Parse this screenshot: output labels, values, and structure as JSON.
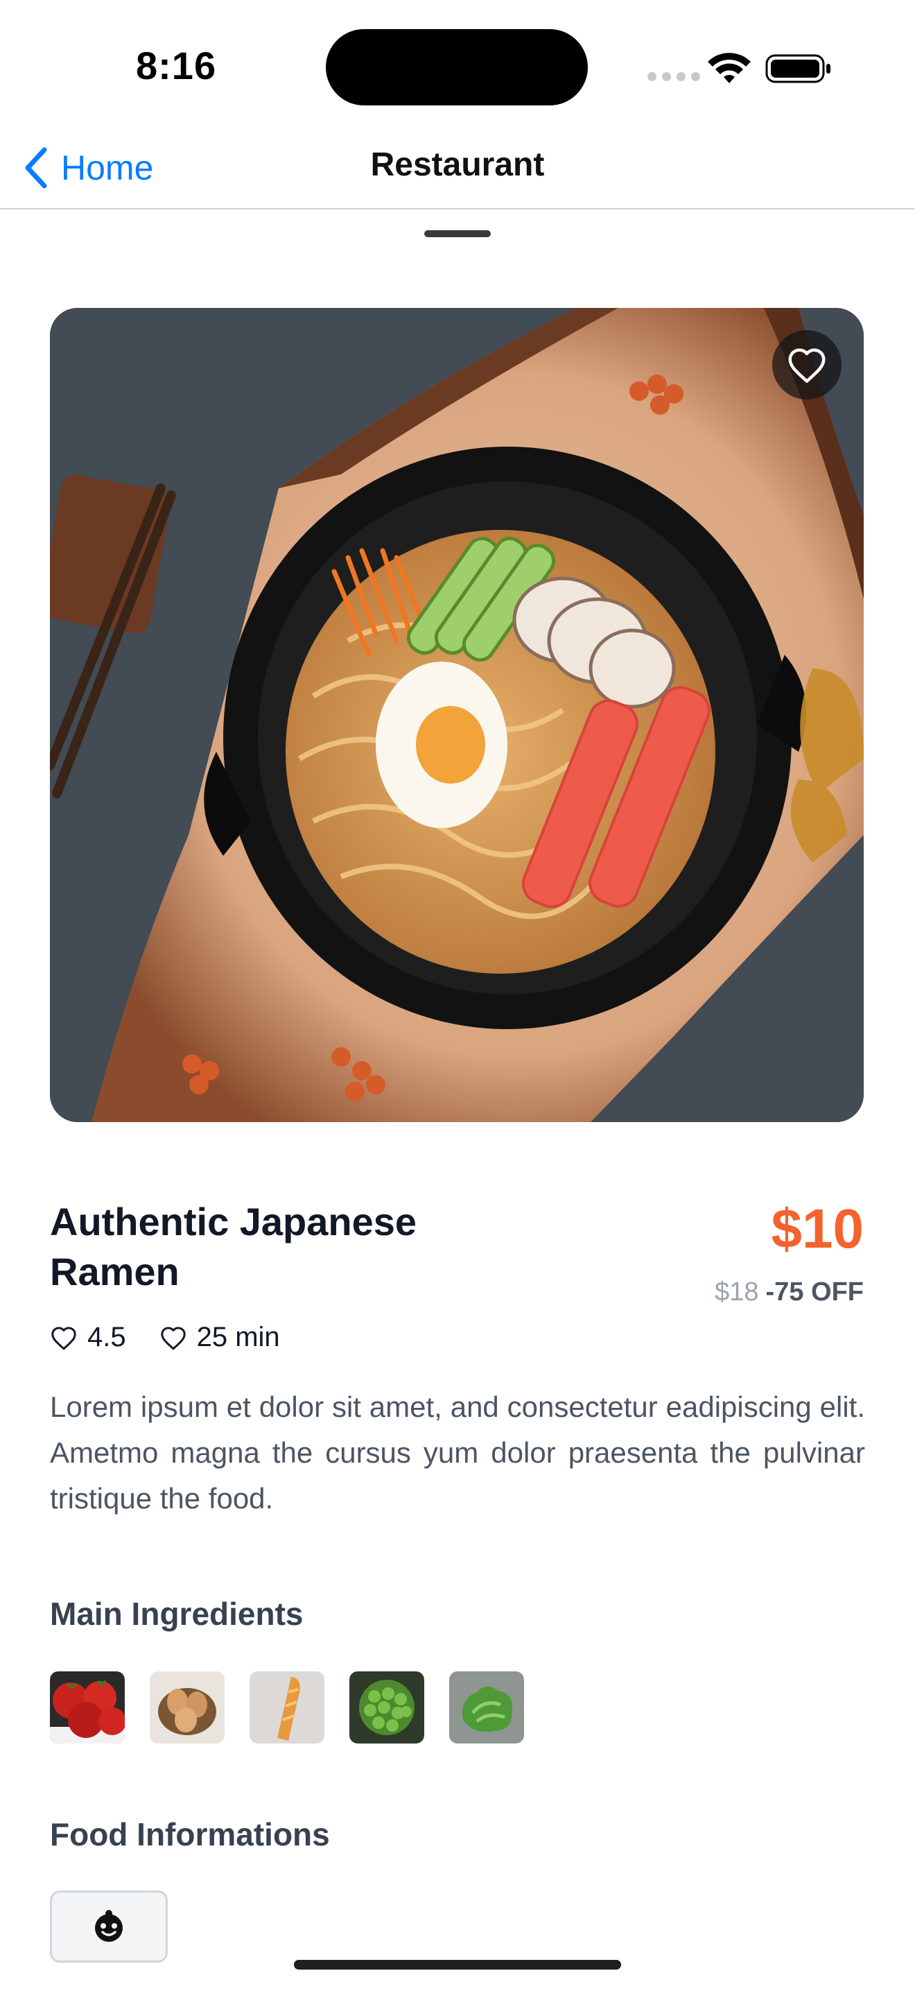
{
  "status_bar": {
    "time": "8:16"
  },
  "nav": {
    "back_label": "Home",
    "title": "Restaurant"
  },
  "dish": {
    "title": "Authentic Japanese Ramen",
    "price": "$10",
    "old_price": "$18",
    "discount": "-75 OFF",
    "rating": "4.5",
    "time": "25 min",
    "description": "Lorem ipsum et dolor sit amet, and consectetur eadipiscing elit. Ametmo magna the cursus yum dolor praesenta the pulvinar tristique the food.",
    "image_icon": "ramen-bowl-photo"
  },
  "sections": {
    "ingredients_heading": "Main Ingredients",
    "food_info_heading": "Food Informations"
  },
  "ingredients": [
    {
      "icon": "tomato-photo"
    },
    {
      "icon": "eggs-photo"
    },
    {
      "icon": "bread-photo"
    },
    {
      "icon": "peas-photo"
    },
    {
      "icon": "lettuce-photo"
    }
  ],
  "food_info": [
    {
      "icon": "baby-face-icon"
    }
  ],
  "colors": {
    "accent_blue": "#0a7cff",
    "price_orange": "#f4622e",
    "text_dark": "#111827",
    "text_muted": "#4b5563"
  }
}
